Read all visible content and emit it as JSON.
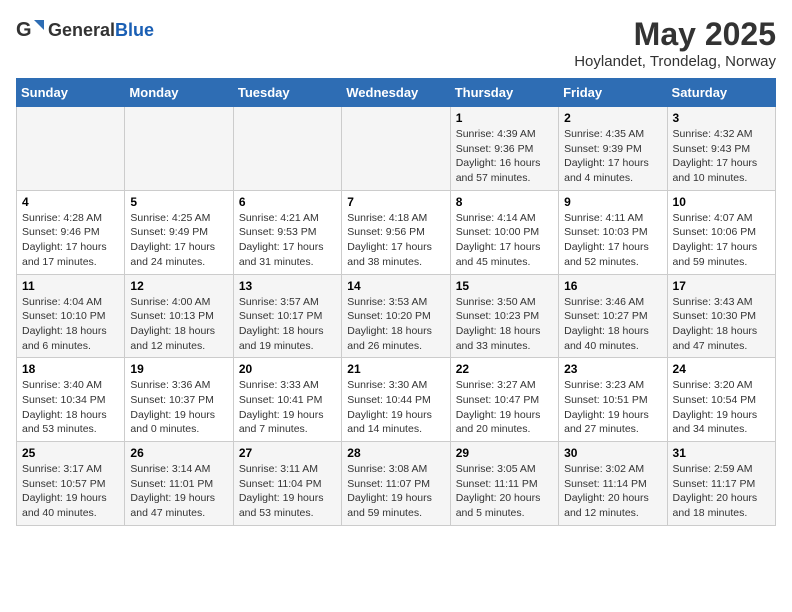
{
  "header": {
    "logo_general": "General",
    "logo_blue": "Blue",
    "title": "May 2025",
    "subtitle": "Hoylandet, Trondelag, Norway"
  },
  "weekdays": [
    "Sunday",
    "Monday",
    "Tuesday",
    "Wednesday",
    "Thursday",
    "Friday",
    "Saturday"
  ],
  "weeks": [
    [
      {
        "day": "",
        "info": ""
      },
      {
        "day": "",
        "info": ""
      },
      {
        "day": "",
        "info": ""
      },
      {
        "day": "",
        "info": ""
      },
      {
        "day": "1",
        "info": "Sunrise: 4:39 AM\nSunset: 9:36 PM\nDaylight: 16 hours\nand 57 minutes."
      },
      {
        "day": "2",
        "info": "Sunrise: 4:35 AM\nSunset: 9:39 PM\nDaylight: 17 hours\nand 4 minutes."
      },
      {
        "day": "3",
        "info": "Sunrise: 4:32 AM\nSunset: 9:43 PM\nDaylight: 17 hours\nand 10 minutes."
      }
    ],
    [
      {
        "day": "4",
        "info": "Sunrise: 4:28 AM\nSunset: 9:46 PM\nDaylight: 17 hours\nand 17 minutes."
      },
      {
        "day": "5",
        "info": "Sunrise: 4:25 AM\nSunset: 9:49 PM\nDaylight: 17 hours\nand 24 minutes."
      },
      {
        "day": "6",
        "info": "Sunrise: 4:21 AM\nSunset: 9:53 PM\nDaylight: 17 hours\nand 31 minutes."
      },
      {
        "day": "7",
        "info": "Sunrise: 4:18 AM\nSunset: 9:56 PM\nDaylight: 17 hours\nand 38 minutes."
      },
      {
        "day": "8",
        "info": "Sunrise: 4:14 AM\nSunset: 10:00 PM\nDaylight: 17 hours\nand 45 minutes."
      },
      {
        "day": "9",
        "info": "Sunrise: 4:11 AM\nSunset: 10:03 PM\nDaylight: 17 hours\nand 52 minutes."
      },
      {
        "day": "10",
        "info": "Sunrise: 4:07 AM\nSunset: 10:06 PM\nDaylight: 17 hours\nand 59 minutes."
      }
    ],
    [
      {
        "day": "11",
        "info": "Sunrise: 4:04 AM\nSunset: 10:10 PM\nDaylight: 18 hours\nand 6 minutes."
      },
      {
        "day": "12",
        "info": "Sunrise: 4:00 AM\nSunset: 10:13 PM\nDaylight: 18 hours\nand 12 minutes."
      },
      {
        "day": "13",
        "info": "Sunrise: 3:57 AM\nSunset: 10:17 PM\nDaylight: 18 hours\nand 19 minutes."
      },
      {
        "day": "14",
        "info": "Sunrise: 3:53 AM\nSunset: 10:20 PM\nDaylight: 18 hours\nand 26 minutes."
      },
      {
        "day": "15",
        "info": "Sunrise: 3:50 AM\nSunset: 10:23 PM\nDaylight: 18 hours\nand 33 minutes."
      },
      {
        "day": "16",
        "info": "Sunrise: 3:46 AM\nSunset: 10:27 PM\nDaylight: 18 hours\nand 40 minutes."
      },
      {
        "day": "17",
        "info": "Sunrise: 3:43 AM\nSunset: 10:30 PM\nDaylight: 18 hours\nand 47 minutes."
      }
    ],
    [
      {
        "day": "18",
        "info": "Sunrise: 3:40 AM\nSunset: 10:34 PM\nDaylight: 18 hours\nand 53 minutes."
      },
      {
        "day": "19",
        "info": "Sunrise: 3:36 AM\nSunset: 10:37 PM\nDaylight: 19 hours\nand 0 minutes."
      },
      {
        "day": "20",
        "info": "Sunrise: 3:33 AM\nSunset: 10:41 PM\nDaylight: 19 hours\nand 7 minutes."
      },
      {
        "day": "21",
        "info": "Sunrise: 3:30 AM\nSunset: 10:44 PM\nDaylight: 19 hours\nand 14 minutes."
      },
      {
        "day": "22",
        "info": "Sunrise: 3:27 AM\nSunset: 10:47 PM\nDaylight: 19 hours\nand 20 minutes."
      },
      {
        "day": "23",
        "info": "Sunrise: 3:23 AM\nSunset: 10:51 PM\nDaylight: 19 hours\nand 27 minutes."
      },
      {
        "day": "24",
        "info": "Sunrise: 3:20 AM\nSunset: 10:54 PM\nDaylight: 19 hours\nand 34 minutes."
      }
    ],
    [
      {
        "day": "25",
        "info": "Sunrise: 3:17 AM\nSunset: 10:57 PM\nDaylight: 19 hours\nand 40 minutes."
      },
      {
        "day": "26",
        "info": "Sunrise: 3:14 AM\nSunset: 11:01 PM\nDaylight: 19 hours\nand 47 minutes."
      },
      {
        "day": "27",
        "info": "Sunrise: 3:11 AM\nSunset: 11:04 PM\nDaylight: 19 hours\nand 53 minutes."
      },
      {
        "day": "28",
        "info": "Sunrise: 3:08 AM\nSunset: 11:07 PM\nDaylight: 19 hours\nand 59 minutes."
      },
      {
        "day": "29",
        "info": "Sunrise: 3:05 AM\nSunset: 11:11 PM\nDaylight: 20 hours\nand 5 minutes."
      },
      {
        "day": "30",
        "info": "Sunrise: 3:02 AM\nSunset: 11:14 PM\nDaylight: 20 hours\nand 12 minutes."
      },
      {
        "day": "31",
        "info": "Sunrise: 2:59 AM\nSunset: 11:17 PM\nDaylight: 20 hours\nand 18 minutes."
      }
    ]
  ]
}
